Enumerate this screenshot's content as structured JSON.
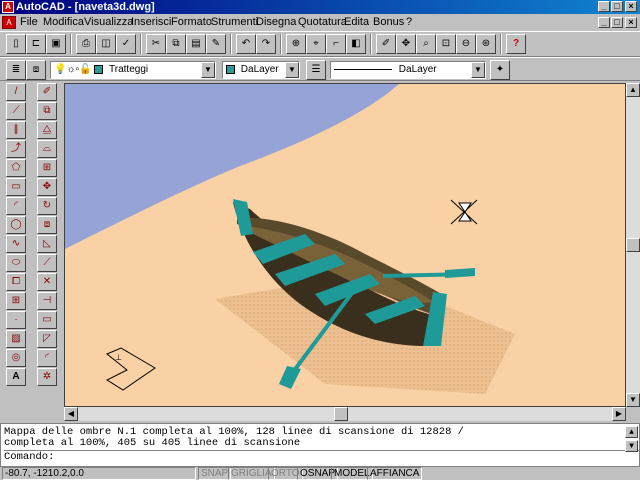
{
  "window": {
    "title": "AutoCAD - [naveta3d.dwg]"
  },
  "menu": {
    "items": [
      {
        "label": "File"
      },
      {
        "label": "Modifica"
      },
      {
        "label": "Visualizza"
      },
      {
        "label": "Inserisci"
      },
      {
        "label": "Formato"
      },
      {
        "label": "Strumenti"
      },
      {
        "label": "Disegna"
      },
      {
        "label": "Quotatura"
      },
      {
        "label": "Edita"
      },
      {
        "label": "Bonus"
      },
      {
        "label": "?"
      }
    ]
  },
  "properties_bar": {
    "layer_value": "Tratteggi",
    "color_value": "DaLayer",
    "linetype_value": "DaLayer",
    "accent_color": "#2a9d9a"
  },
  "command": {
    "history_line1": "Mappa delle ombre N.1 completa al 100%, 128 linee di scansione di 12828 /",
    "history_line2": "completa al 100%, 405 su 405 linee di scansione",
    "prompt": "Comando:"
  },
  "status": {
    "coords": "-80.7, -1210.2,0.0",
    "snap": "SNAP",
    "grid": "GRIGLIA",
    "ortho": "ORTO",
    "osnap": "OSNAP",
    "model": "MODEL",
    "tile": "AFFIANCA"
  },
  "scene": {
    "sand_color": "#f9d1a4",
    "water_color": "#95a3d6",
    "boat_color": "#3a2f1c",
    "boat_accent": "#1e9a98"
  }
}
